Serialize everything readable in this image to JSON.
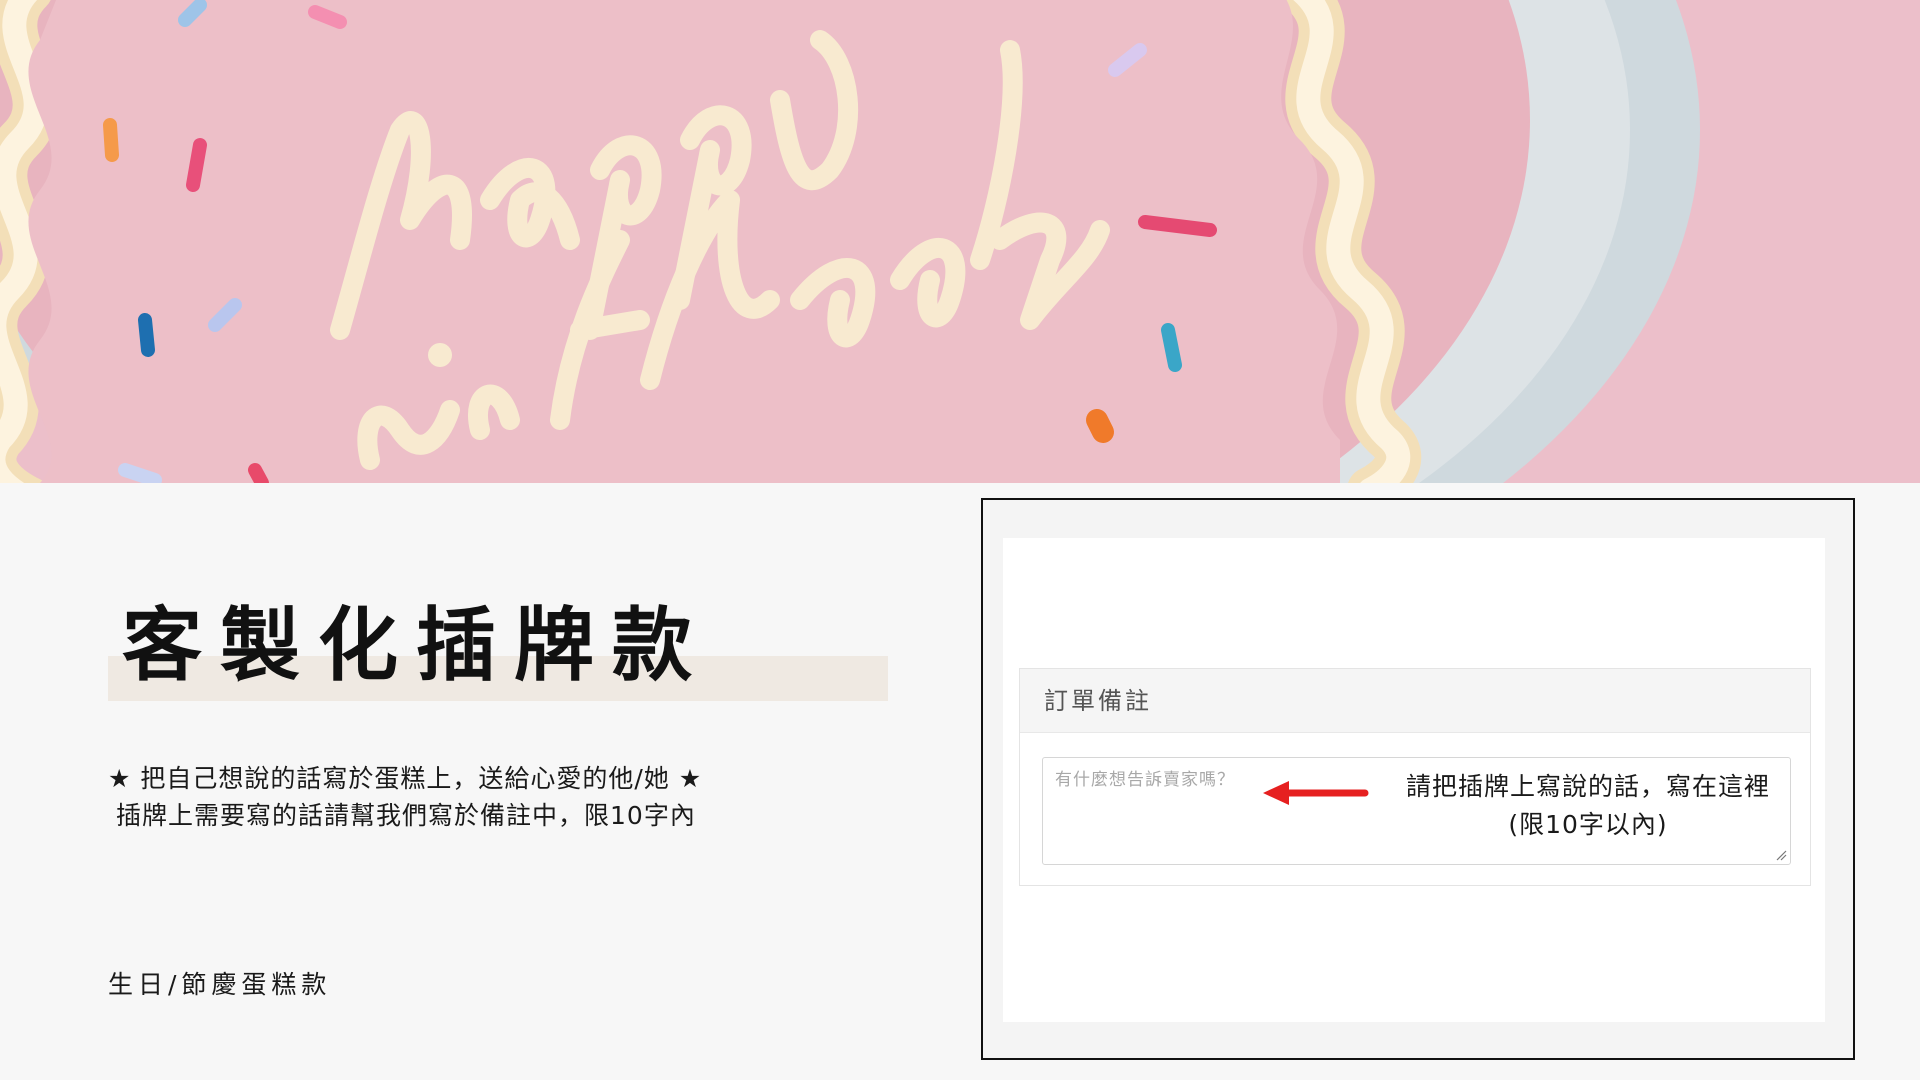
{
  "hero": {
    "image": "pink-birthday-cake-photo",
    "cake_text": "happy birthday"
  },
  "title": "客製化插牌款",
  "description": {
    "line1": "★ 把自己想說的話寫於蛋糕上，送給心愛的他/她 ★",
    "line2": "插牌上需要寫的話請幫我們寫於備註中，限10字內"
  },
  "category": "生日/節慶蛋糕款",
  "order_note": {
    "header": "訂單備註",
    "placeholder": "有什麼想告訴賣家嗎？",
    "hint_line1": "請把插牌上寫說的話，寫在這裡",
    "hint_line2": "(限10字以內)"
  },
  "colors": {
    "cake_pink": "#e9b7c1",
    "cream": "#fbefd6",
    "title_band": "#efe9e2",
    "arrow_red": "#e62020"
  }
}
